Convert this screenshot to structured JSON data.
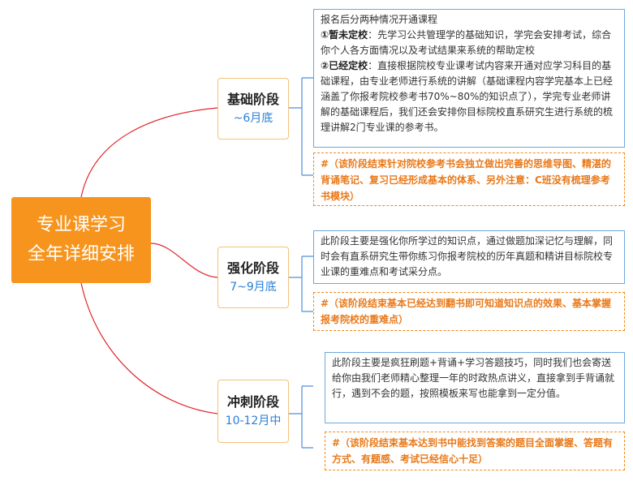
{
  "root": {
    "line1": "专业课学习",
    "line2": "全年详细安排"
  },
  "stages": [
    {
      "name": "基础阶段",
      "time": "~6月底",
      "intro": "报名后分两种情况开通课程",
      "case1_label": "①暂未定校",
      "case1_text": "：先学习公共管理学的基础知识，学完会安排考试，综合你个人各方面情况以及考试结果来系统的帮助定校",
      "case2_label": "②已经定校",
      "case2_text": "：直接根据院校专业课考试内容来开通对应学习科目的基础课程，由专业老师进行系统的讲解（基础课程内容学完基本上已经涵盖了你报考院校参考书70%~80%的知识点了），学完专业老师讲解的基础课程后，我们还会安排你目标院校直系研究生进行系统的梳理讲解2门专业课的参考书。",
      "note": "#（该阶段结束针对院校参考书会独立做出完善的思维导图、精湛的背诵笔记、复习已经形成基本的体系、另外注意：C班没有梳理参考书模块）"
    },
    {
      "name": "强化阶段",
      "time": "7~9月底",
      "desc": "此阶段主要是强化你所学过的知识点，通过做题加深记忆与理解，同时会有直系研究生带你练习你报考院校的历年真题和精讲目标院校专业课的重难点和考试采分点。",
      "note": "#（该阶段结束基本已经达到翻书即可知道知识点的效果、基本掌握报考院校的重难点）"
    },
    {
      "name": "冲刺阶段",
      "time": "10-12月中",
      "desc": "此阶段主要是疯狂刷题+背诵+学习答题技巧，同时我们也会寄送给你由我们老师精心整理一年的时政热点讲义，直接拿到手背诵就行，遇到不会的题，按照模板来写也能拿到一定分值。",
      "note": "#（该阶段结束基本达到书中能找到答案的题目全面掌握、答题有方式、有题感、考试已经信心十足）"
    }
  ],
  "colors": {
    "root_bg": "#f7941d",
    "branch_line": "#e0282e",
    "bracket_line": "#4a90d9",
    "time_text": "#2b7fd8",
    "note_text": "#e8791a"
  }
}
